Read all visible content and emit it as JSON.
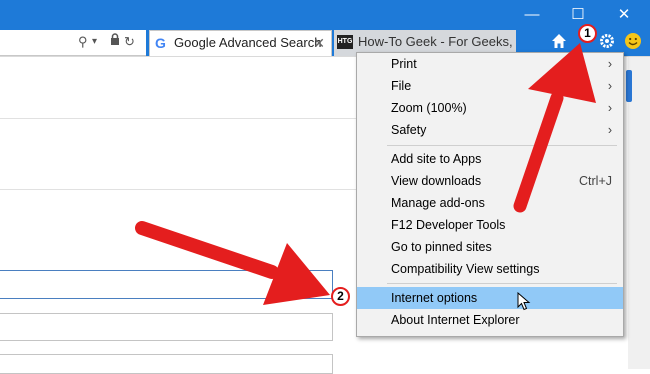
{
  "window": {
    "minimize_label": "—",
    "maximize_label": "☐",
    "close_label": "✕"
  },
  "tabs": [
    {
      "label": "Google Advanced Search",
      "close": "✕",
      "favicon_text": "G"
    },
    {
      "label": "How-To Geek - For Geeks, ...",
      "favicon_text": "HTG"
    }
  ],
  "menu": {
    "items": [
      {
        "label": "Print",
        "right": "›"
      },
      {
        "label": "File",
        "right": "›"
      },
      {
        "label": "Zoom (100%)",
        "right": "›"
      },
      {
        "label": "Safety",
        "right": "›"
      },
      {
        "label": "Add site to Apps",
        "right": ""
      },
      {
        "label": "View downloads",
        "right": "Ctrl+J"
      },
      {
        "label": "Manage add-ons",
        "right": ""
      },
      {
        "label": "F12 Developer Tools",
        "right": ""
      },
      {
        "label": "Go to pinned sites",
        "right": ""
      },
      {
        "label": "Compatibility View settings",
        "right": ""
      },
      {
        "label": "Internet options",
        "right": ""
      },
      {
        "label": "About Internet Explorer",
        "right": ""
      }
    ]
  },
  "annotations": {
    "badge1": "1",
    "badge2": "2"
  },
  "colors": {
    "titlebar": "#1e7ad8",
    "highlight": "#91c9f7",
    "annotation_red": "#e41e1e"
  }
}
